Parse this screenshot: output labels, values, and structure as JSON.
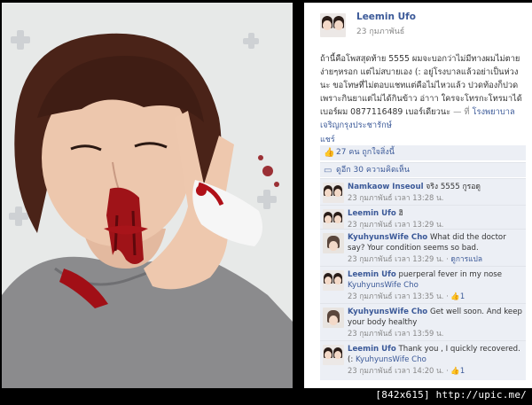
{
  "post": {
    "author": "Leemin Ufo",
    "date": "23 กุมภาพันธ์",
    "body": "ถ้านี้คือโพสสุดท้าย 5555 ผมจะบอกว่าไม่มีทางผมไม่ตายง่ายๆหรอก แต่ไม่สบายเอง (: อยู่โรงบาลแล้วอย่าเป็นห่วงนะ ขอโทษที่ไม่ตอบแชทแต่คือไม่ไหวแล้ว ปวดท้องก็ปวดเพราะกินยาแต่ไม่ได้กินข้าว อ่าาา ใครจะโทรกะโทรมาได้ เบอร์ผม 0877116489 เบอร์เดียวนะ",
    "separator": "— ที่",
    "place": "โรงพยาบาลเจริญกรุงประชารักษ์",
    "share_label": "แชร์",
    "likes_label": "27 คน ถูกใจสิ่งนี้",
    "shares_label": "ดูอีก 30 ความคิดเห็น"
  },
  "comments": [
    {
      "name": "Namkaow Inseoul",
      "text": "จริง 5555 กูรอดู",
      "tag": "",
      "meta": "23 กุมภาพันธ์ เวลา 13:28 น.",
      "meta_extra": ""
    },
    {
      "name": "Leemin Ufo",
      "text": "ฮิ",
      "tag": "",
      "meta": "23 กุมภาพันธ์ เวลา 13:29 น.",
      "meta_extra": ""
    },
    {
      "name": "KyuhyunsWife Cho",
      "text": "What did the doctor say? Your condition seems so bad.",
      "tag": "",
      "meta": "23 กุมภาพันธ์ เวลา 13:29 น.",
      "meta_extra": "ดูการแปล"
    },
    {
      "name": "Leemin Ufo",
      "text": "puerperal fever in my nose",
      "tag": "KyuhyunsWife Cho",
      "meta": "23 กุมภาพันธ์ เวลา 13:35 น.",
      "meta_extra": "1"
    },
    {
      "name": "KyuhyunsWife Cho",
      "text": "Get well soon. And keep your body healthy",
      "tag": "",
      "meta": "23 กุมภาพันธ์ เวลา 13:59 น.",
      "meta_extra": ""
    },
    {
      "name": "Leemin Ufo",
      "text": "Thank you , I quickly recovered. (:",
      "tag": "KyuhyunsWife Cho",
      "meta": "23 กุมภาพันธ์ เวลา 14:20 น.",
      "meta_extra": "1"
    }
  ],
  "watermark": "[842x615] http://upic.me/",
  "colors": {
    "link": "#3b5998",
    "comment_bg": "#eceff5",
    "page_bg": "#000000"
  }
}
